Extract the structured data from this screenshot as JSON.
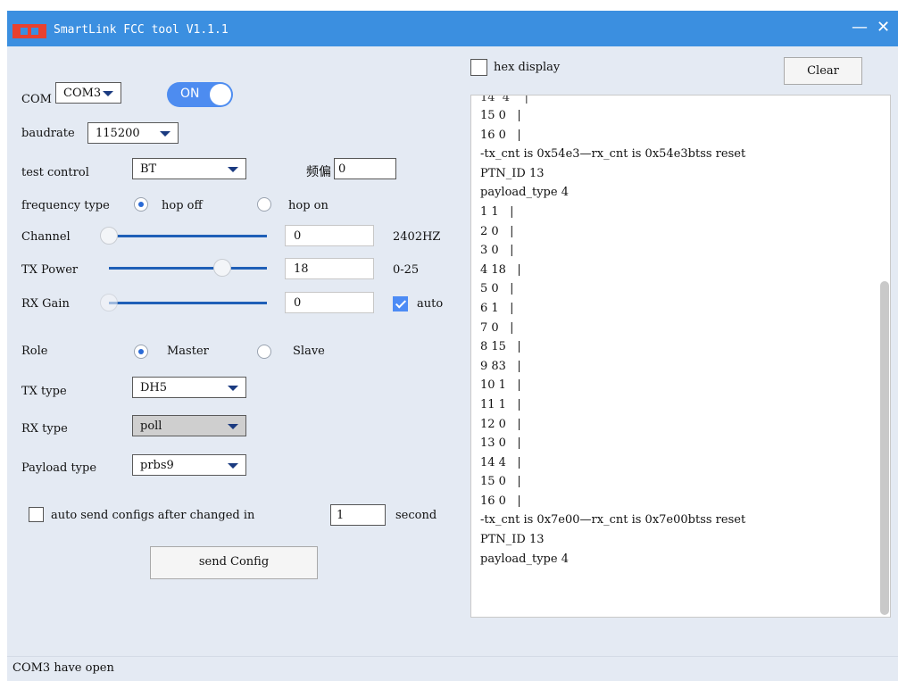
{
  "window": {
    "title": "SmartLink FCC tool V1.1.1",
    "minimize_glyph": "—",
    "close_glyph": "✕"
  },
  "controls": {
    "com_label": "COM",
    "com_value": "COM3",
    "power_toggle": "ON",
    "baudrate_label": "baudrate",
    "baudrate_value": "115200",
    "test_control_label": "test control",
    "test_control_value": "BT",
    "freq_offset_label": "频偏",
    "freq_offset_value": "0",
    "frequency_type_label": "frequency type",
    "hop_off": "hop off",
    "hop_on": "hop on",
    "channel_label": "Channel",
    "channel_value": "0",
    "channel_unit": "2402HZ",
    "tx_power_label": "TX Power",
    "tx_power_value": "18",
    "tx_power_range": "0-25",
    "rx_gain_label": "RX Gain",
    "rx_gain_value": "0",
    "auto_label": "auto",
    "role_label": "Role",
    "role_master": "Master",
    "role_slave": "Slave",
    "tx_type_label": "TX type",
    "tx_type_value": "DH5",
    "rx_type_label": "RX type",
    "rx_type_value": "poll",
    "payload_type_label": "Payload type",
    "payload_type_value": "prbs9",
    "auto_send_label": "auto send configs after changed in",
    "auto_send_value": "1",
    "auto_send_unit": "second",
    "send_button": "send Config"
  },
  "log_panel": {
    "hex_display_label": "hex display",
    "clear_button": "Clear",
    "partial_top_line": "14  4    |",
    "lines": [
      "15 0   |",
      "16 0   |",
      "-tx_cnt is 0x54e3—rx_cnt is 0x54e3btss reset",
      "PTN_ID 13",
      "payload_type 4",
      "1 1   |",
      "2 0   |",
      "3 0   |",
      "4 18   |",
      "5 0   |",
      "6 1   |",
      "7 0   |",
      "8 15   |",
      "9 83   |",
      "10 1   |",
      "11 1   |",
      "12 0   |",
      "13 0   |",
      "14 4   |",
      "15 0   |",
      "16 0   |",
      "-tx_cnt is 0x7e00—rx_cnt is 0x7e00btss reset",
      "PTN_ID 13",
      "payload_type 4"
    ]
  },
  "status": {
    "text": "COM3 have open"
  },
  "colors": {
    "titlebar": "#3b8fe0",
    "client_bg": "#e4eaf3",
    "accent": "#4d8cf0"
  },
  "sliders": {
    "channel_level": 0.0,
    "tx_power_level": 0.72,
    "rx_gain_level": 0.0
  }
}
